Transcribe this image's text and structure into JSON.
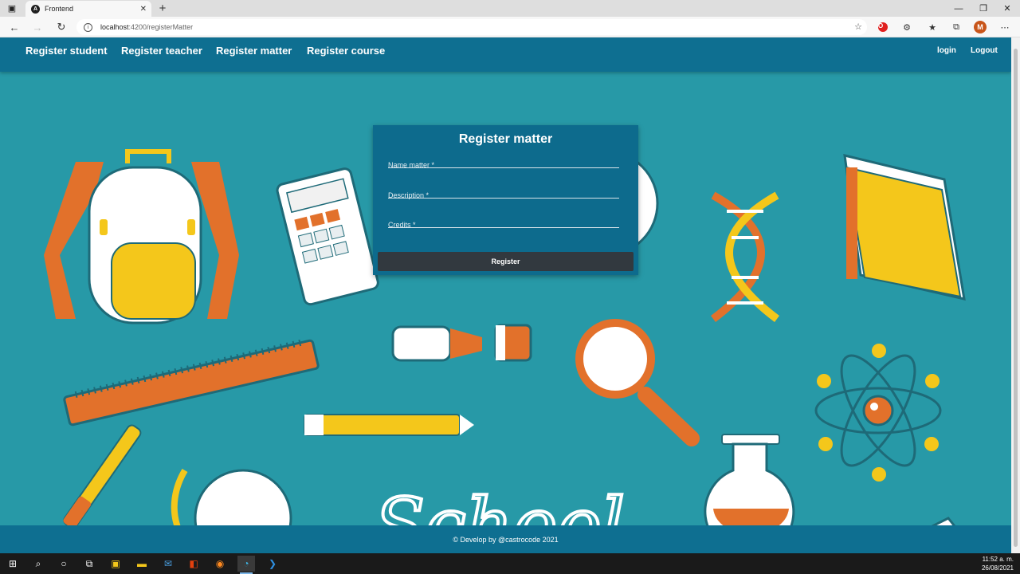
{
  "browser": {
    "tab_title": "Frontend",
    "url_host": "localhost",
    "url_path": ":4200/registerMatter"
  },
  "navbar": {
    "links": [
      "Register student",
      "Register teacher",
      "Register matter",
      "Register course"
    ],
    "login": "login",
    "logout": "Logout"
  },
  "form": {
    "title": "Register matter",
    "fields": [
      {
        "label": "Name matter *",
        "value": ""
      },
      {
        "label": "Description *",
        "value": ""
      },
      {
        "label": "Credits *",
        "value": ""
      }
    ],
    "submit": "Register"
  },
  "background": {
    "text": "School"
  },
  "footer": {
    "text": "© Develop by @castrocode 2021"
  },
  "taskbar": {
    "time": "11:52 a. m.",
    "date": "26/08/2021"
  },
  "colors": {
    "navbar": "#0e6f91",
    "page_bg": "#2799a7",
    "button": "#32393f"
  }
}
